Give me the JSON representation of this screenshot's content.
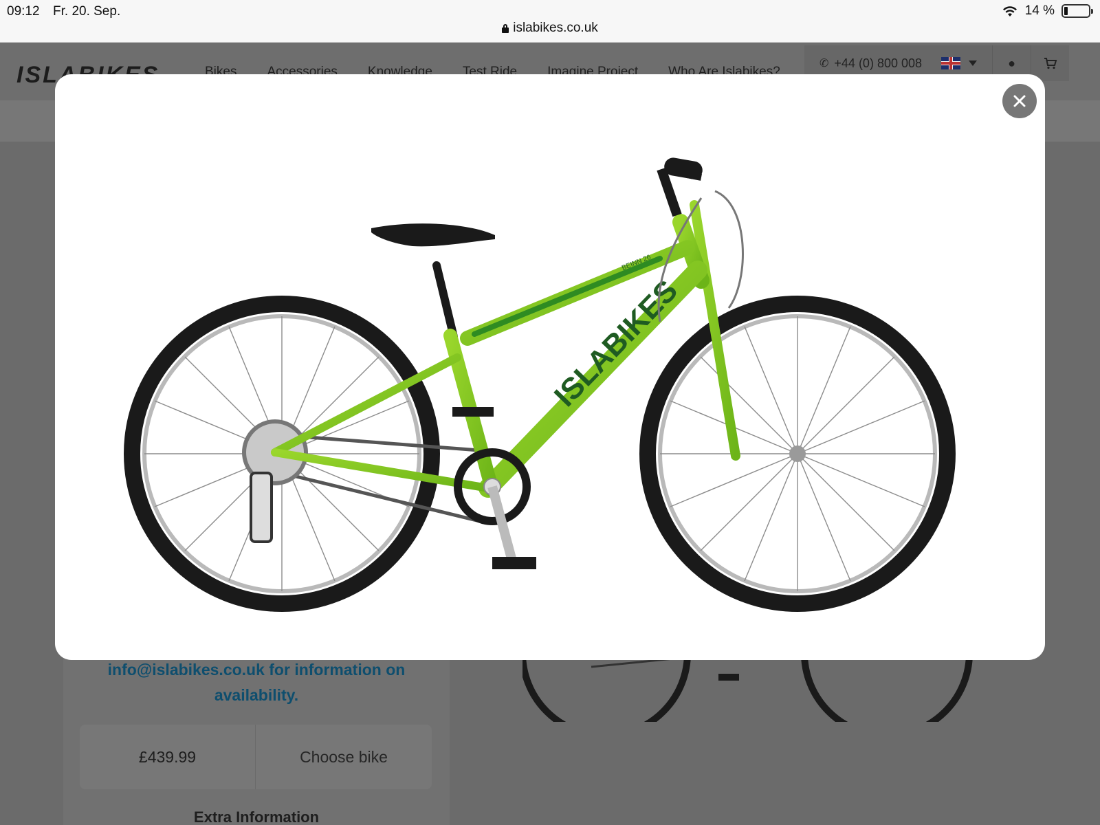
{
  "status_bar": {
    "time": "09:12",
    "date": "Fr. 20. Sep.",
    "battery": "14 %",
    "battery_level": 0.14
  },
  "browser": {
    "url": "islabikes.co.uk"
  },
  "site": {
    "logo": "ISLABIKES",
    "nav": [
      "Bikes",
      "Accessories",
      "Knowledge",
      "Test Ride",
      "Imagine Project",
      "Who Are Islabikes?"
    ],
    "phone": "+44 (0) 800 008",
    "language": "English (UK)"
  },
  "product_panel": {
    "info_text_line1": "info@islabikes.co.uk for information on",
    "info_text_line2": "availability.",
    "price": "£439.99",
    "choose_label": "Choose bike",
    "extra_heading": "Extra Information"
  },
  "modal": {
    "frame_brand_text": "ISLABIKES",
    "frame_model_text": "BEINN 26"
  },
  "colors": {
    "frame_green": "#7cc21e",
    "frame_dark_green": "#2e8b22",
    "link_blue": "#0e4e6e",
    "overlay_gray": "#6b6b6b"
  },
  "icons": [
    "wifi-icon",
    "battery-icon",
    "lock-icon",
    "phone-icon",
    "flag-uk-icon",
    "chevron-down-icon",
    "user-icon",
    "cart-icon",
    "close-icon"
  ]
}
